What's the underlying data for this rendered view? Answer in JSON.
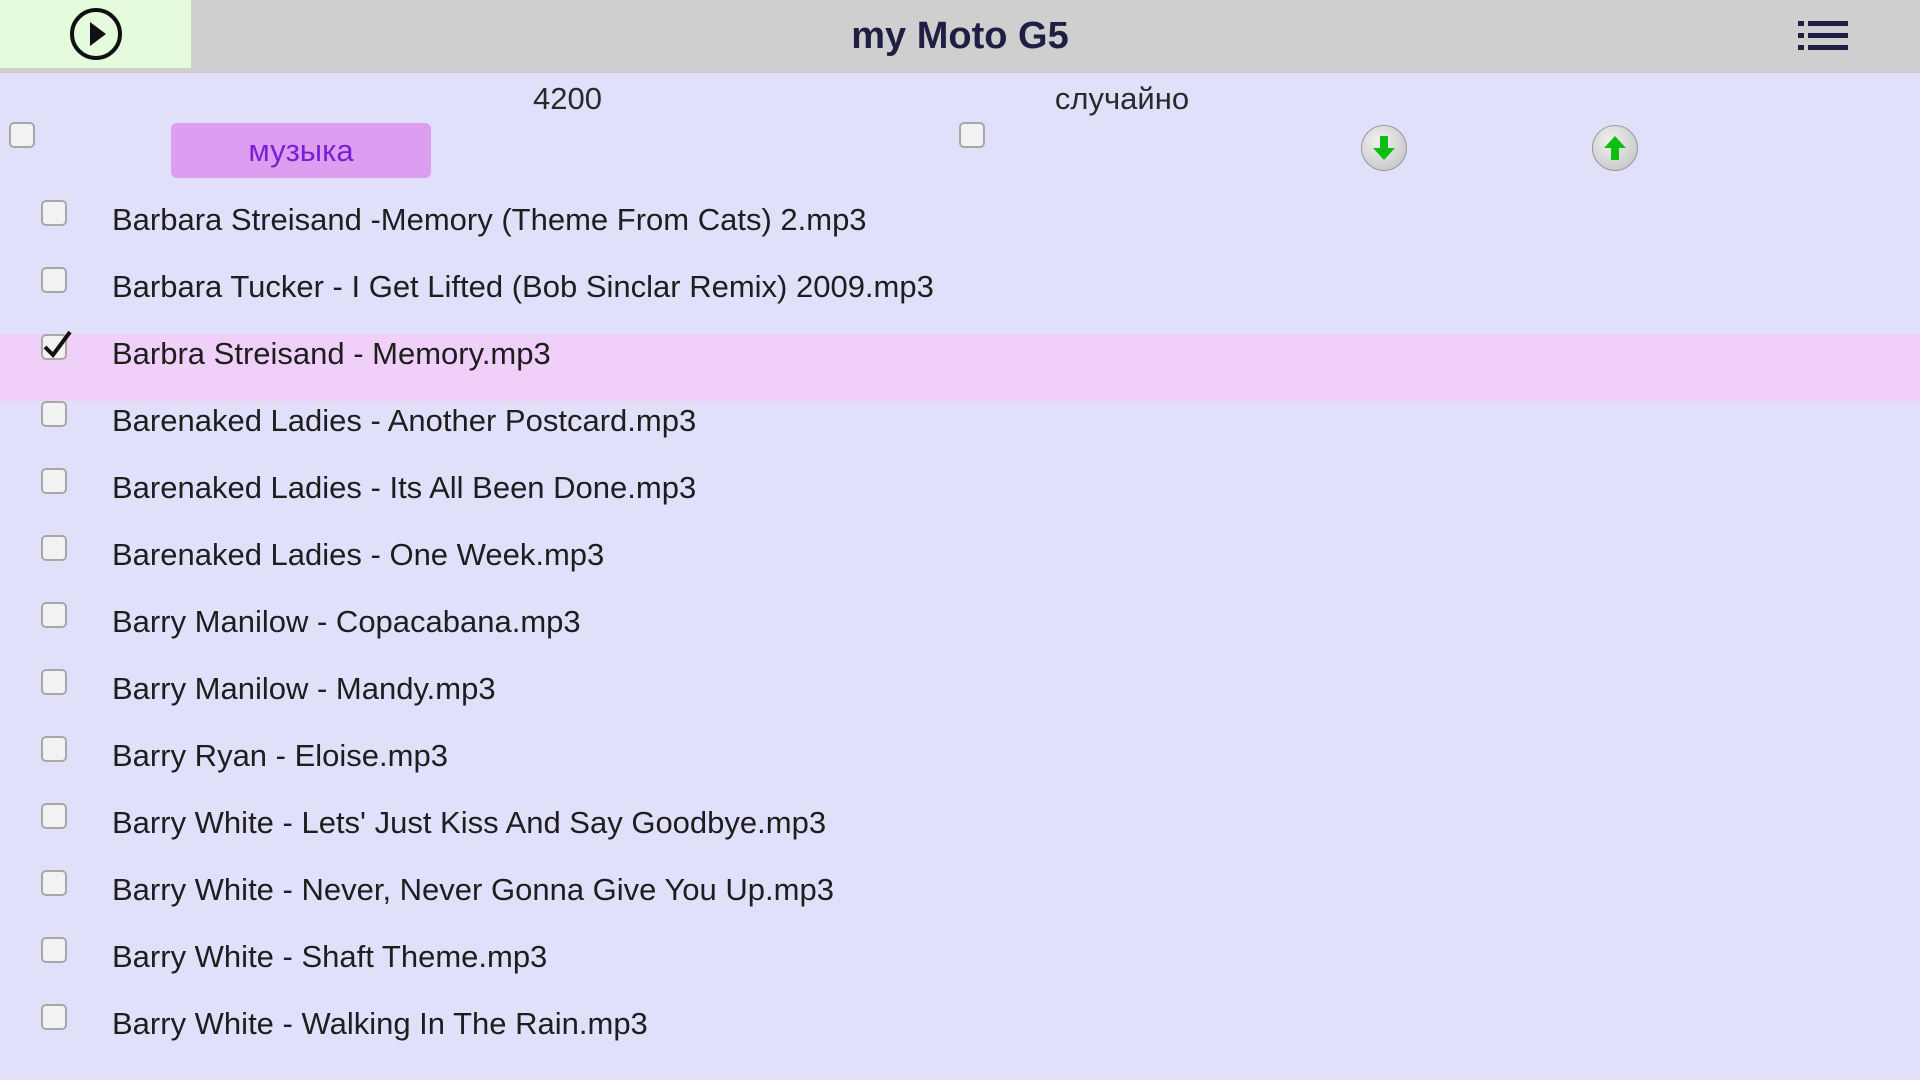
{
  "app": {
    "title": "my Moto G5"
  },
  "icons": {
    "play": "play-circle-icon",
    "menu": "list-menu-icon",
    "down": "arrow-down-icon",
    "up": "arrow-up-icon"
  },
  "colors": {
    "titlebar": "#cfcfcf",
    "background": "#e0e0fb",
    "selected_row": "#f0cff8",
    "music_button": "#dd9df0",
    "arrow": "#0fbf0f"
  },
  "controls": {
    "count": "4200",
    "shuffle_label": "случайно",
    "shuffle_checked": false,
    "select_all_checked": false,
    "music_button_label": "музыка"
  },
  "files": [
    {
      "name": "Barbara Streisand -Memory (Theme From Cats) 2.mp3",
      "checked": false
    },
    {
      "name": "Barbara Tucker - I Get Lifted (Bob Sinclar Remix) 2009.mp3",
      "checked": false
    },
    {
      "name": "Barbra Streisand - Memory.mp3",
      "checked": true
    },
    {
      "name": "Barenaked Ladies - Another Postcard.mp3",
      "checked": false
    },
    {
      "name": "Barenaked Ladies - Its All Been Done.mp3",
      "checked": false
    },
    {
      "name": "Barenaked Ladies - One Week.mp3",
      "checked": false
    },
    {
      "name": "Barry Manilow - Copacabana.mp3",
      "checked": false
    },
    {
      "name": "Barry Manilow - Mandy.mp3",
      "checked": false
    },
    {
      "name": "Barry Ryan - Eloise.mp3",
      "checked": false
    },
    {
      "name": "Barry White  - Lets' Just Kiss And Say Goodbye.mp3",
      "checked": false
    },
    {
      "name": "Barry White - Never, Never Gonna Give You Up.mp3",
      "checked": false
    },
    {
      "name": "Barry White - Shaft Theme.mp3",
      "checked": false
    },
    {
      "name": "Barry White - Walking In The Rain.mp3",
      "checked": false
    }
  ]
}
